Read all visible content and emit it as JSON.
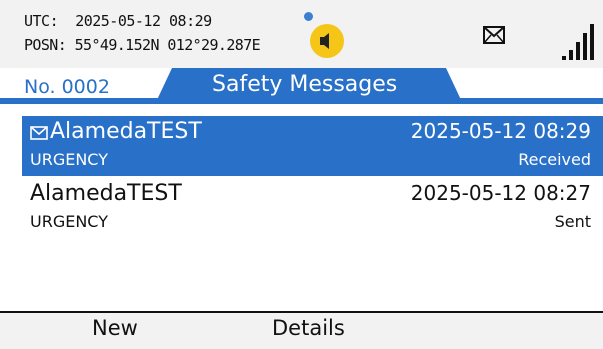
{
  "status_bar": {
    "utc_label": "UTC:",
    "utc_value": "2025-05-12 08:29",
    "posn_label": "POSN:",
    "posn_value": "55°49.152N 012°29.287E",
    "icons": [
      "alert-dot",
      "speaker-alarm-icon",
      "envelope-icon",
      "signal-strength-icon"
    ],
    "alarm_color": "#f5c518",
    "dot_color": "#3a7fd0"
  },
  "tabs": {
    "number_label": "No. 0002",
    "active_label": "Safety Messages",
    "accent_color": "#2870c8"
  },
  "messages": [
    {
      "sender": "AlamedaTEST",
      "priority": "URGENCY",
      "datetime": "2025-05-12 08:29",
      "status": "Received",
      "selected": true,
      "icon": "envelope-icon"
    },
    {
      "sender": "AlamedaTEST",
      "priority": "URGENCY",
      "datetime": "2025-05-12 08:27",
      "status": "Sent",
      "selected": false
    }
  ],
  "softkeys": {
    "left": "New",
    "middle": "Details"
  }
}
